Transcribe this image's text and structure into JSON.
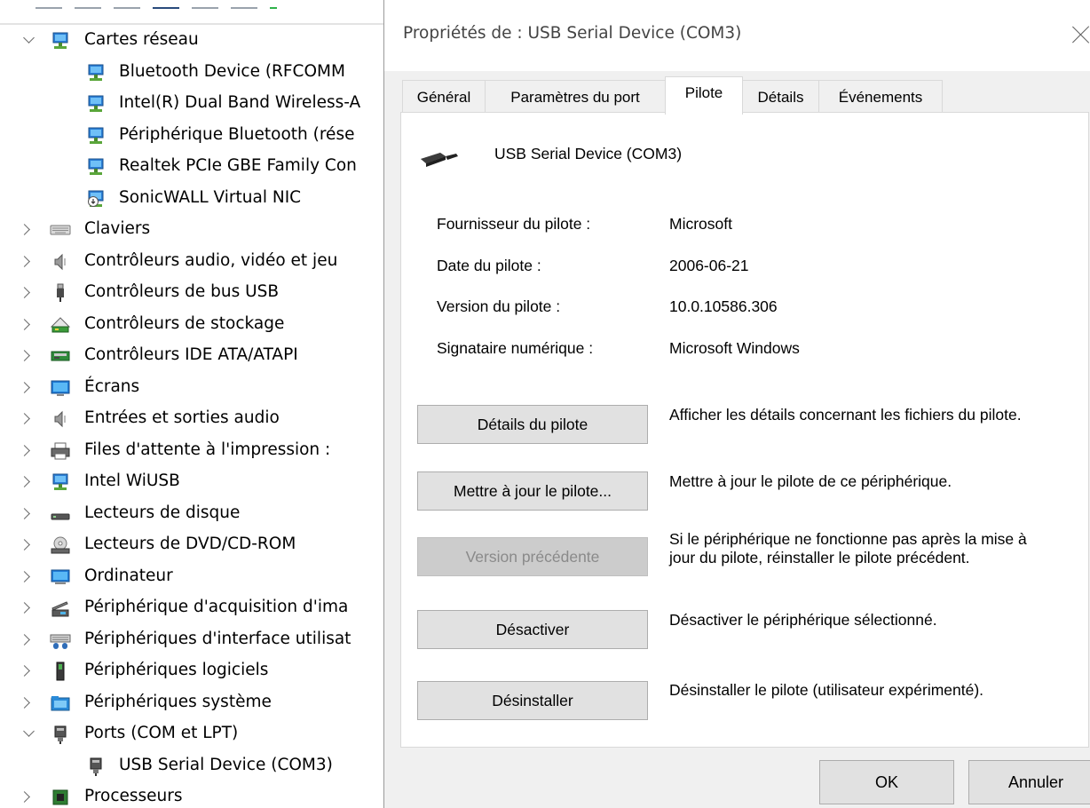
{
  "tree": {
    "items": [
      {
        "label": "Cartes réseau",
        "level": 0,
        "state": "expanded",
        "icon": "network-adapter-icon"
      },
      {
        "label": "Bluetooth Device (RFCOMM",
        "level": 1,
        "state": "leaf",
        "icon": "network-adapter-icon"
      },
      {
        "label": "Intel(R) Dual Band Wireless-A",
        "level": 1,
        "state": "leaf",
        "icon": "network-adapter-icon"
      },
      {
        "label": "Périphérique Bluetooth (rése",
        "level": 1,
        "state": "leaf",
        "icon": "network-adapter-icon"
      },
      {
        "label": "Realtek PCIe GBE Family Con",
        "level": 1,
        "state": "leaf",
        "icon": "network-adapter-icon"
      },
      {
        "label": "SonicWALL Virtual NIC",
        "level": 1,
        "state": "leaf",
        "icon": "virtual-nic-icon"
      },
      {
        "label": "Claviers",
        "level": 0,
        "state": "collapsed",
        "icon": "keyboard-icon"
      },
      {
        "label": "Contrôleurs audio, vidéo et jeu",
        "level": 0,
        "state": "collapsed",
        "icon": "speaker-icon"
      },
      {
        "label": "Contrôleurs de bus USB",
        "level": 0,
        "state": "collapsed",
        "icon": "usb-plug-icon"
      },
      {
        "label": "Contrôleurs de stockage",
        "level": 0,
        "state": "collapsed",
        "icon": "storage-controller-icon"
      },
      {
        "label": "Contrôleurs IDE ATA/ATAPI",
        "level": 0,
        "state": "collapsed",
        "icon": "ide-controller-icon"
      },
      {
        "label": "Écrans",
        "level": 0,
        "state": "collapsed",
        "icon": "monitor-icon"
      },
      {
        "label": "Entrées et sorties audio",
        "level": 0,
        "state": "collapsed",
        "icon": "speaker-icon"
      },
      {
        "label": "Files d'attente à l'impression :",
        "level": 0,
        "state": "collapsed",
        "icon": "printer-icon"
      },
      {
        "label": "Intel WiUSB",
        "level": 0,
        "state": "collapsed",
        "icon": "network-adapter-icon"
      },
      {
        "label": "Lecteurs de disque",
        "level": 0,
        "state": "collapsed",
        "icon": "disk-drive-icon"
      },
      {
        "label": "Lecteurs de DVD/CD-ROM",
        "level": 0,
        "state": "collapsed",
        "icon": "dvd-drive-icon"
      },
      {
        "label": "Ordinateur",
        "level": 0,
        "state": "collapsed",
        "icon": "computer-icon"
      },
      {
        "label": "Périphérique d'acquisition d'ima",
        "level": 0,
        "state": "collapsed",
        "icon": "scanner-icon"
      },
      {
        "label": "Périphériques d'interface utilisat",
        "level": 0,
        "state": "collapsed",
        "icon": "hid-icon"
      },
      {
        "label": "Périphériques logiciels",
        "level": 0,
        "state": "collapsed",
        "icon": "software-device-icon"
      },
      {
        "label": "Périphériques système",
        "level": 0,
        "state": "collapsed",
        "icon": "system-folder-icon"
      },
      {
        "label": "Ports (COM et LPT)",
        "level": 0,
        "state": "expanded",
        "icon": "port-icon"
      },
      {
        "label": "USB Serial Device (COM3)",
        "level": 1,
        "state": "leaf",
        "icon": "port-icon"
      },
      {
        "label": "Processeurs",
        "level": 0,
        "state": "collapsed",
        "icon": "processor-icon"
      }
    ]
  },
  "dialog": {
    "title": "Propriétés de : USB Serial Device (COM3)",
    "tabs": [
      "Général",
      "Paramètres du port",
      "Pilote",
      "Détails",
      "Événements"
    ],
    "active_tab": "Pilote",
    "device_name": "USB Serial Device (COM3)",
    "info": [
      {
        "label": "Fournisseur du pilote :",
        "value": "Microsoft"
      },
      {
        "label": "Date du pilote :",
        "value": "2006-06-21"
      },
      {
        "label": "Version du pilote :",
        "value": "10.0.10586.306"
      },
      {
        "label": "Signataire numérique :",
        "value": "Microsoft Windows"
      }
    ],
    "actions": [
      {
        "button": "Détails du pilote",
        "description": "Afficher les détails concernant les fichiers du pilote.",
        "enabled": true
      },
      {
        "button": "Mettre à jour le pilote...",
        "description": "Mettre à jour le pilote de ce périphérique.",
        "enabled": true
      },
      {
        "button": "Version précédente",
        "description": "Si le périphérique ne fonctionne pas après la mise à jour du pilote, réinstaller le pilote précédent.",
        "enabled": false
      },
      {
        "button": "Désactiver",
        "description": "Désactiver le périphérique sélectionné.",
        "enabled": true
      },
      {
        "button": "Désinstaller",
        "description": "Désinstaller le pilote (utilisateur expérimenté).",
        "enabled": true
      }
    ],
    "ok_label": "OK",
    "cancel_label": "Annuler"
  }
}
